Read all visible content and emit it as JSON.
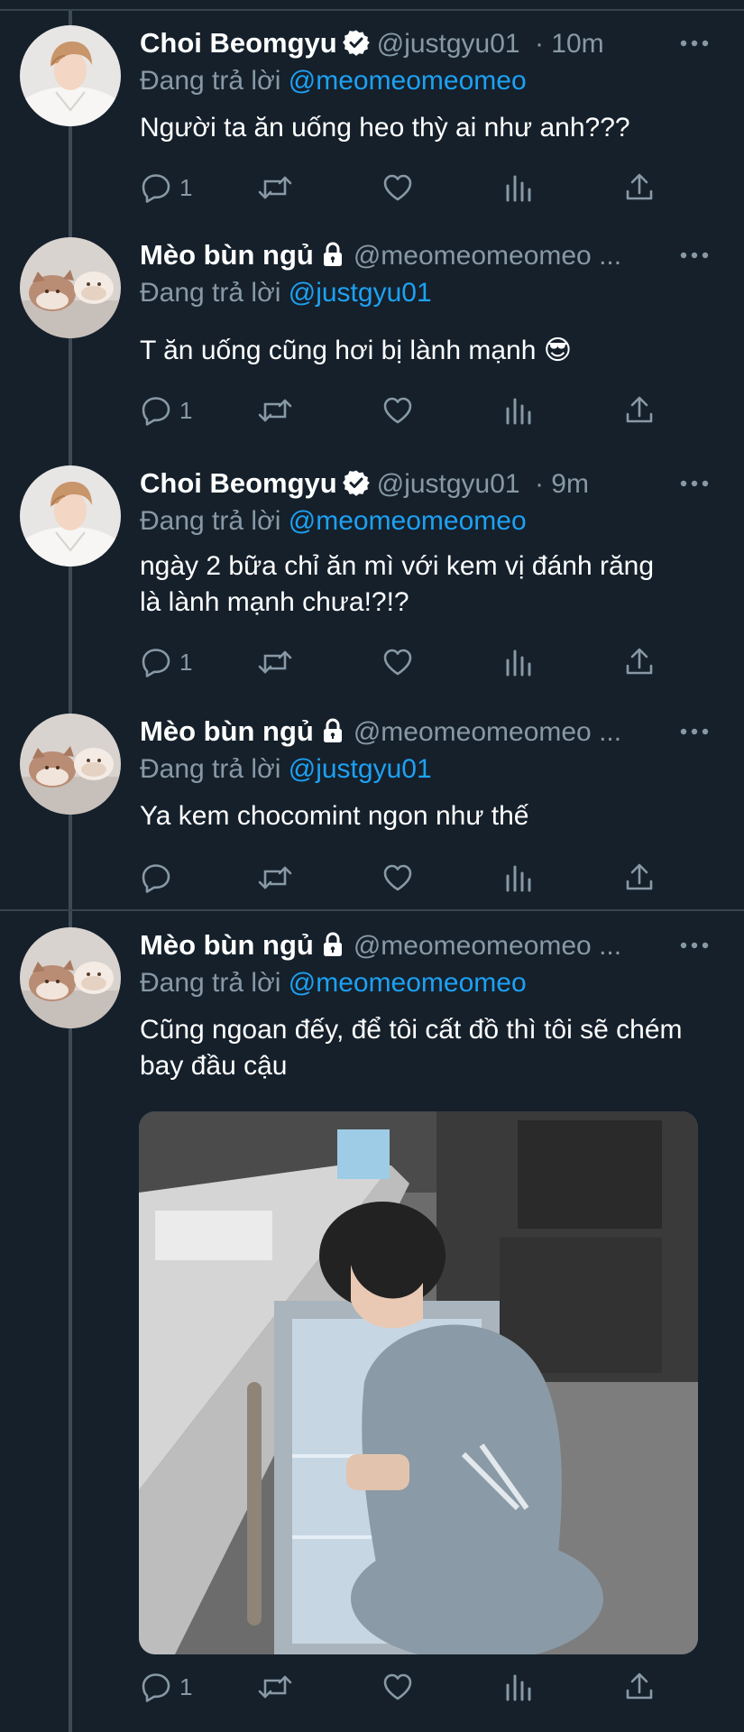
{
  "tweets": [
    {
      "name": "Choi Beomgyu",
      "verified": true,
      "handle": "@justgyu01",
      "time": "· 10m",
      "reply_prefix": "Đang trả lời",
      "reply_to": "@meomeomeomeo",
      "text": "Người ta ăn uống heo thỳ ai như anh???",
      "reply_count": "1"
    },
    {
      "name": "Mèo bùn ngủ",
      "locked": true,
      "handle": "@meomeomeomeo ...",
      "reply_prefix": "Đang trả lời",
      "reply_to": "@justgyu01",
      "text": "T ăn uống cũng hơi bị lành mạnh 😎",
      "reply_count": "1"
    },
    {
      "name": "Choi Beomgyu",
      "verified": true,
      "handle": "@justgyu01",
      "time": "· 9m",
      "reply_prefix": "Đang trả lời",
      "reply_to": "@meomeomeomeo",
      "text": "ngày 2 bữa chỉ ăn mì với kem vị đánh răng là lành mạnh chưa!?!?",
      "reply_count": "1"
    },
    {
      "name": "Mèo bùn ngủ",
      "locked": true,
      "handle": "@meomeomeomeo ...",
      "reply_prefix": "Đang trả lời",
      "reply_to": "@justgyu01",
      "text": "Ya kem chocomint ngon như thế",
      "reply_count": ""
    },
    {
      "name": "Mèo bùn ngủ",
      "locked": true,
      "handle": "@meomeomeomeo ...",
      "reply_prefix": "Đang trả lời",
      "reply_to": "@meomeomeomeo",
      "text": "Cũng ngoan đếy, để tôi cất đồ thì tôi sẽ chém bay đầu cậu",
      "reply_count": "1",
      "has_media": true
    }
  ],
  "icons": {
    "reply": "reply-icon",
    "retweet": "retweet-icon",
    "like": "heart-icon",
    "analytics": "analytics-icon",
    "share": "share-icon",
    "more": "more-dots-icon",
    "verified": "verified-badge-icon",
    "locked": "lock-icon"
  },
  "colors": {
    "background": "#15202b",
    "muted": "#8899a6",
    "link": "#1da1f2",
    "divider": "#38444d"
  }
}
